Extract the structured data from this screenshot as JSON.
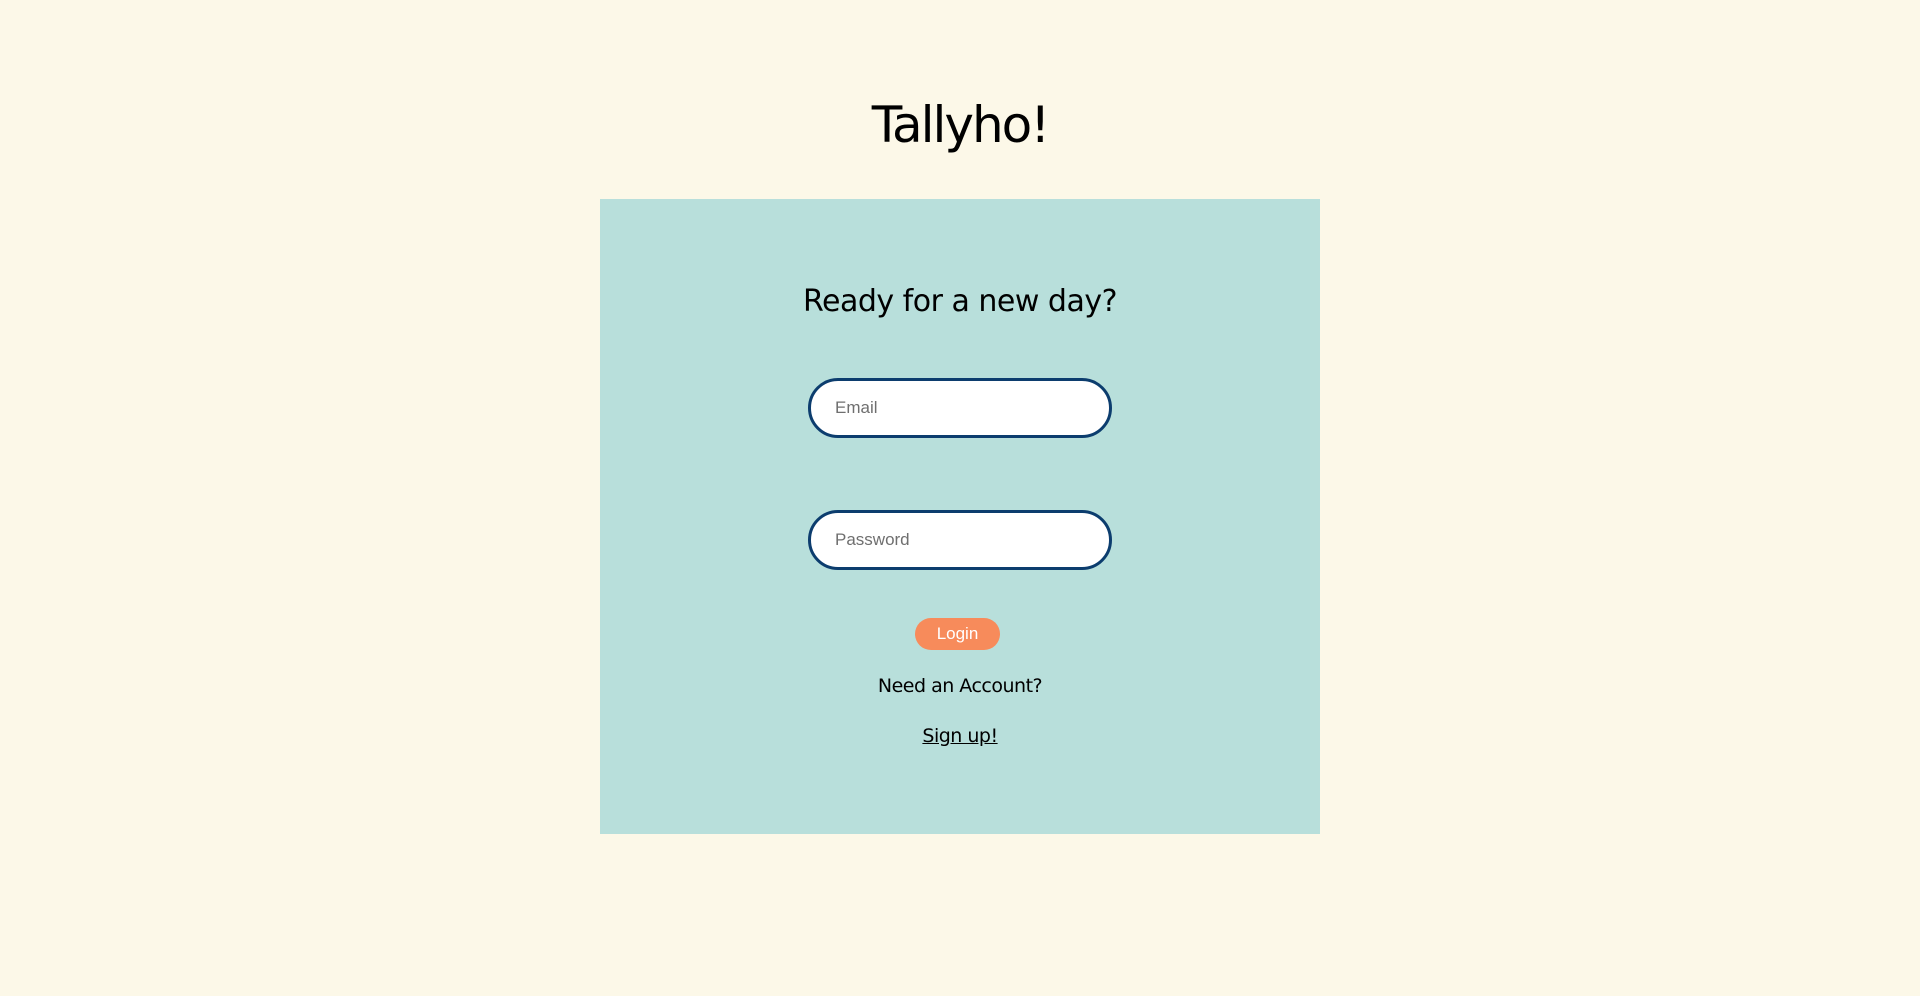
{
  "app": {
    "title": "Tallyho!"
  },
  "login": {
    "heading": "Ready for a new day?",
    "email_placeholder": "Email",
    "password_placeholder": "Password",
    "login_label": "Login",
    "account_prompt": "Need an Account?",
    "signup_label": "Sign up!"
  },
  "colors": {
    "page_background": "#fcf8e8",
    "card_background": "#b8dfdb",
    "input_border": "#0c3d6e",
    "button_background": "#f78b5b",
    "button_text": "#ffffff"
  }
}
